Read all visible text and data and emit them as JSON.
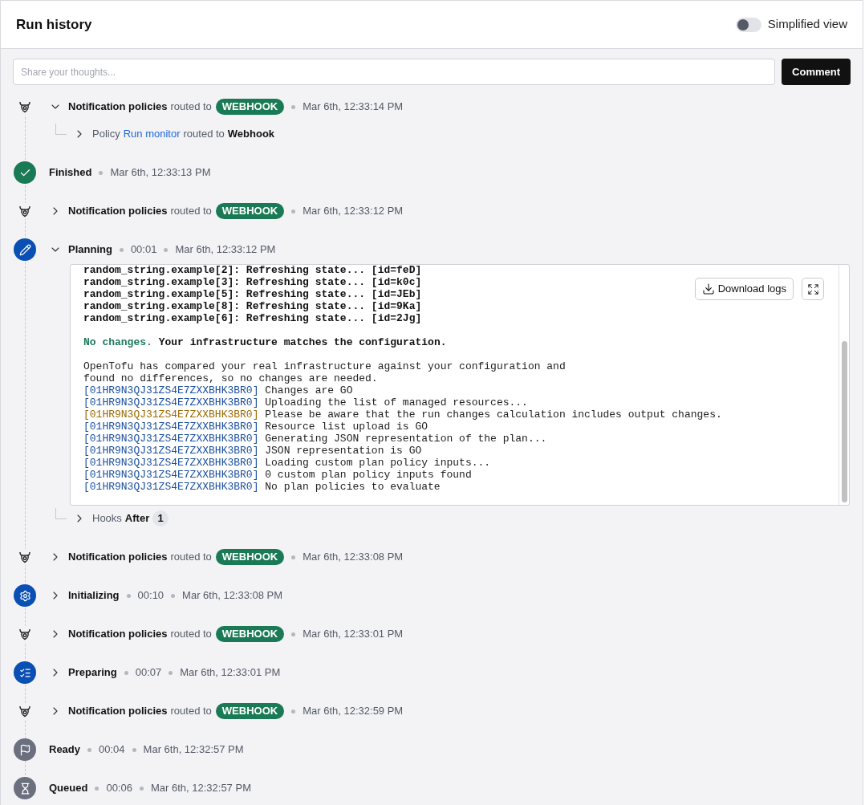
{
  "header": {
    "title": "Run history",
    "simplified_view": {
      "label": "Simplified view",
      "on": false
    }
  },
  "comment": {
    "placeholder": "Share your thoughts...",
    "button": "Comment"
  },
  "events": [
    {
      "kind": "notification",
      "expanded": true,
      "title": "Notification policies",
      "connector": "routed to",
      "badge": "WEBHOOK",
      "time": "Mar 6th, 12:33:14 PM",
      "children": [
        {
          "prefix": "Policy",
          "link": "Run monitor",
          "connector": "routed to",
          "target": "Webhook",
          "expanded": false
        }
      ]
    },
    {
      "kind": "finished",
      "color": "#1a7a55",
      "label": "Finished",
      "time": "Mar 6th, 12:33:13 PM"
    },
    {
      "kind": "notification",
      "expanded": false,
      "title": "Notification policies",
      "connector": "routed to",
      "badge": "WEBHOOK",
      "time": "Mar 6th, 12:33:12 PM"
    },
    {
      "kind": "planning",
      "color": "#0a4fb4",
      "label": "Planning",
      "expanded": true,
      "duration": "00:01",
      "time": "Mar 6th, 12:33:12 PM",
      "log": {
        "download": "Download logs",
        "blocks": [
          [
            {
              "kind": "resource",
              "text": "random_string.example[2]: Refreshing state... [id=feD]"
            },
            {
              "kind": "resource",
              "text": "random_string.example[3]: Refreshing state... [id=k0c]"
            },
            {
              "kind": "resource",
              "text": "random_string.example[5]: Refreshing state... [id=JEb]"
            },
            {
              "kind": "resource",
              "text": "random_string.example[8]: Refreshing state... [id=9Ka]"
            },
            {
              "kind": "resource",
              "text": "random_string.example[6]: Refreshing state... [id=2Jg]"
            }
          ],
          [
            {
              "kind": "summary",
              "status": "No changes.",
              "text": " Your infrastructure matches the configuration."
            }
          ],
          [
            {
              "kind": "message",
              "text": "OpenTofu has compared your real infrastructure against your configuration and"
            },
            {
              "kind": "message",
              "text": "found no differences, so no changes are needed."
            },
            {
              "kind": "info",
              "tag": "[01HR9N3QJ31ZS4E7ZXXBHK3BR0]",
              "text": " Changes are GO"
            },
            {
              "kind": "info",
              "tag": "[01HR9N3QJ31ZS4E7ZXXBHK3BR0]",
              "text": " Uploading the list of managed resources..."
            },
            {
              "kind": "warning",
              "tag": "[01HR9N3QJ31ZS4E7ZXXBHK3BR0]",
              "text": " Please be aware that the run changes calculation includes output changes."
            },
            {
              "kind": "info",
              "tag": "[01HR9N3QJ31ZS4E7ZXXBHK3BR0]",
              "text": " Resource list upload is GO"
            },
            {
              "kind": "info",
              "tag": "[01HR9N3QJ31ZS4E7ZXXBHK3BR0]",
              "text": " Generating JSON representation of the plan..."
            },
            {
              "kind": "info",
              "tag": "[01HR9N3QJ31ZS4E7ZXXBHK3BR0]",
              "text": " JSON representation is GO"
            },
            {
              "kind": "info",
              "tag": "[01HR9N3QJ31ZS4E7ZXXBHK3BR0]",
              "text": " Loading custom plan policy inputs..."
            },
            {
              "kind": "info",
              "tag": "[01HR9N3QJ31ZS4E7ZXXBHK3BR0]",
              "text": " 0 custom plan policy inputs found"
            },
            {
              "kind": "info",
              "tag": "[01HR9N3QJ31ZS4E7ZXXBHK3BR0]",
              "text": " No plan policies to evaluate"
            }
          ]
        ]
      },
      "hooks": {
        "label": "Hooks",
        "phase": "After",
        "count": "1",
        "expanded": false
      }
    },
    {
      "kind": "notification",
      "expanded": false,
      "title": "Notification policies",
      "connector": "routed to",
      "badge": "WEBHOOK",
      "time": "Mar 6th, 12:33:08 PM"
    },
    {
      "kind": "initializing",
      "color": "#0a4fb4",
      "label": "Initializing",
      "expanded": false,
      "duration": "00:10",
      "time": "Mar 6th, 12:33:08 PM"
    },
    {
      "kind": "notification",
      "expanded": false,
      "title": "Notification policies",
      "connector": "routed to",
      "badge": "WEBHOOK",
      "time": "Mar 6th, 12:33:01 PM"
    },
    {
      "kind": "preparing",
      "color": "#0a4fb4",
      "label": "Preparing",
      "expanded": false,
      "duration": "00:07",
      "time": "Mar 6th, 12:33:01 PM"
    },
    {
      "kind": "notification",
      "expanded": false,
      "title": "Notification policies",
      "connector": "routed to",
      "badge": "WEBHOOK",
      "time": "Mar 6th, 12:32:59 PM"
    },
    {
      "kind": "ready",
      "color": "#6b6f7e",
      "label": "Ready",
      "duration": "00:04",
      "time": "Mar 6th, 12:32:57 PM"
    },
    {
      "kind": "queued",
      "color": "#6b6f7e",
      "label": "Queued",
      "duration": "00:06",
      "time": "Mar 6th, 12:32:57 PM"
    }
  ]
}
